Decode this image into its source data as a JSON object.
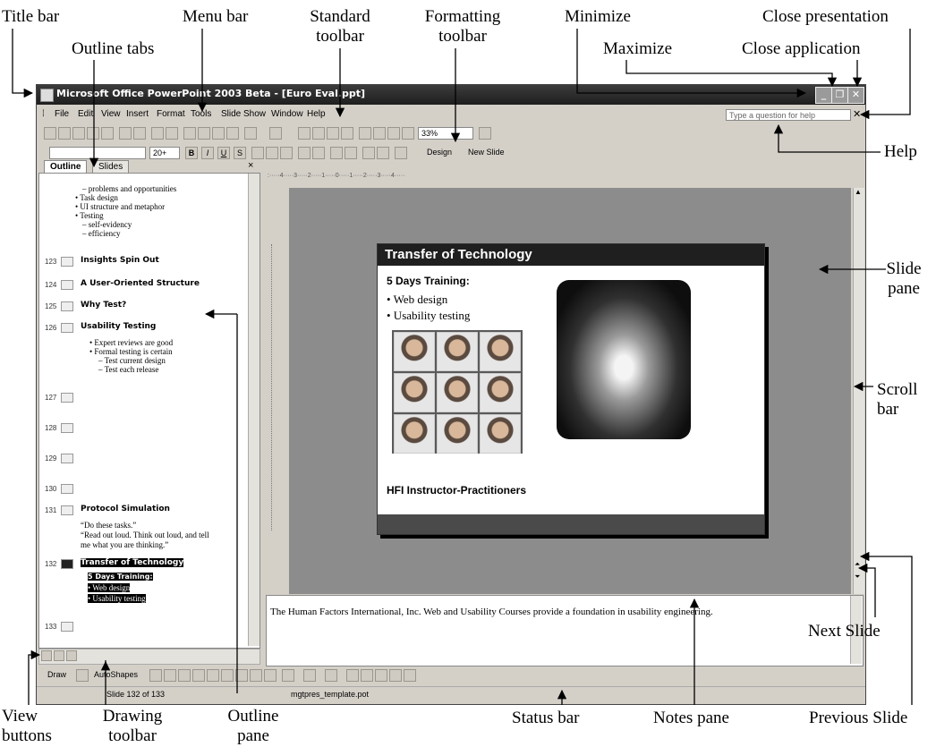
{
  "window": {
    "title": "Microsoft Office PowerPoint 2003 Beta - [Euro Eval.ppt]",
    "minimize_glyph": "_",
    "maximize_glyph": "❐",
    "close_glyph": "✕"
  },
  "menu": {
    "items": [
      "File",
      "Edit",
      "View",
      "Insert",
      "Format",
      "Tools",
      "Slide Show",
      "Window",
      "Help"
    ],
    "help_placeholder": "Type a question for help",
    "close_doc_glyph": "✕"
  },
  "formatting": {
    "font_size": "20+",
    "bold": "B",
    "italic": "I",
    "underline": "U",
    "shadow": "S",
    "design_label": "Design",
    "new_slide_label": "New Slide"
  },
  "standard": {
    "zoom": "33%"
  },
  "outline_tabs": [
    "Outline",
    "Slides"
  ],
  "outline_close": "×",
  "outline": {
    "pre_lines": [
      "– problems and opportunities",
      "• Task design",
      "• UI structure and metaphor",
      "• Testing",
      "– self-evidency",
      "– efficiency"
    ],
    "slides": [
      {
        "num": "123",
        "title": "Insights Spin Out"
      },
      {
        "num": "124",
        "title": "A User-Oriented Structure"
      },
      {
        "num": "125",
        "title": "Why Test?"
      },
      {
        "num": "126",
        "title": "Usability Testing"
      },
      {
        "num": "127",
        "title": ""
      },
      {
        "num": "128",
        "title": ""
      },
      {
        "num": "129",
        "title": ""
      },
      {
        "num": "130",
        "title": ""
      },
      {
        "num": "131",
        "title": "Protocol Simulation"
      },
      {
        "num": "132",
        "title": "Transfer of Technology"
      },
      {
        "num": "133",
        "title": ""
      }
    ],
    "usability_bullets": [
      "• Expert reviews are good",
      "• Formal testing is certain",
      "– Test current design",
      "– Test each release"
    ],
    "protocol_lines": [
      "“Do these tasks.”",
      "“Read out loud. Think out loud, and tell",
      "me what you are thinking.”"
    ],
    "transfer_lines": [
      "5 Days Training:",
      "• Web design",
      "• Usability testing"
    ]
  },
  "slide": {
    "title": "Transfer of Technology",
    "subtitle": "5 Days Training:",
    "bullets": [
      "• Web design",
      "• Usability testing"
    ],
    "caption": "HFI Instructor-Practitioners"
  },
  "notes_text": "The Human Factors International, Inc. Web and Usability Courses provide a foundation in usability engineering.",
  "drawing": {
    "draw_label": "Draw",
    "autoshapes_label": "AutoShapes"
  },
  "status": {
    "slide_info": "Slide 132 of 133",
    "template": "mgtpres_template.pot"
  },
  "callouts": {
    "title_bar": "Title bar",
    "menu_bar": "Menu bar",
    "standard_toolbar": [
      "Standard",
      "toolbar"
    ],
    "formatting_toolbar": [
      "Formatting",
      "toolbar"
    ],
    "minimize": "Minimize",
    "close_presentation": "Close presentation",
    "maximize": "Maximize",
    "close_application": "Close  application",
    "outline_tabs": "Outline tabs",
    "help": "Help",
    "slide_pane": [
      "Slide",
      "pane"
    ],
    "scroll_bar": [
      "Scroll",
      "bar"
    ],
    "next_slide": "Next Slide",
    "previous_slide": "Previous Slide",
    "view_buttons": [
      "View",
      "buttons"
    ],
    "drawing_toolbar": [
      "Drawing",
      "toolbar"
    ],
    "outline_pane": [
      "Outline",
      "pane"
    ],
    "status_bar": "Status bar",
    "notes_pane": "Notes pane"
  }
}
